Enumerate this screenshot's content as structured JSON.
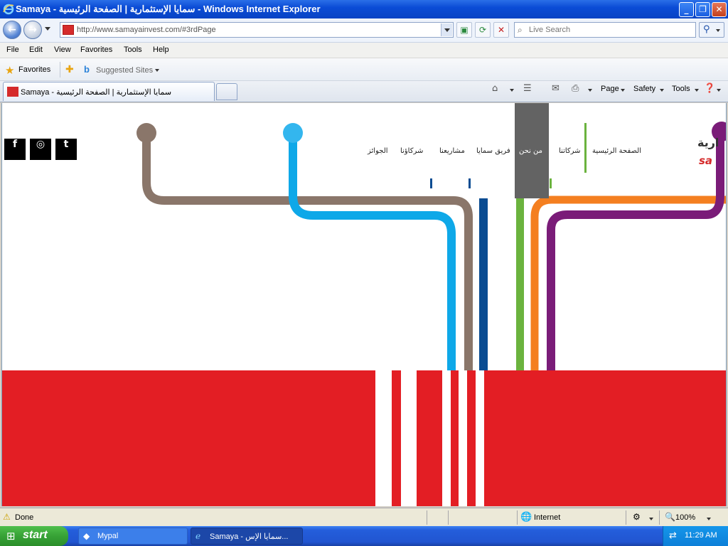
{
  "window": {
    "title": "Samaya - سمايا الإستثمارية | الصفحة الرئيسية - Windows Internet Explorer",
    "minimize": "_",
    "restore": "❐",
    "close": "✕"
  },
  "address_bar": {
    "url": "http://www.samayainvest.com/#3rdPage",
    "search_placeholder": "Live Search"
  },
  "menu": [
    "File",
    "Edit",
    "View",
    "Favorites",
    "Tools",
    "Help"
  ],
  "favorites_bar": {
    "favorites_label": "Favorites",
    "suggested_label": "Suggested Sites"
  },
  "tab": {
    "label": "Samaya - سمايا الإستثمارية | الصفحة الرئيسية"
  },
  "command_bar": {
    "page": "Page",
    "safety": "Safety",
    "tools": "Tools"
  },
  "site": {
    "nav": [
      "الصفحة الرئيسية",
      "شركاتنا",
      "من نحن",
      "فريق سمايا",
      "مشاريعنا",
      "شركاؤنا",
      "الجوائز"
    ],
    "logo_ar": "ارية",
    "logo_en": "sa",
    "social": [
      "f",
      "◎",
      "t"
    ],
    "colors": {
      "brown": "#8a766a",
      "light_blue": "#0ea8e8",
      "dark_blue": "#0a4c92",
      "green": "#6bb33e",
      "orange": "#f47f20",
      "purple": "#7a1c78",
      "red": "#e31e24",
      "nav_active": "#636363"
    }
  },
  "status_bar": {
    "status": "Done",
    "zone": "Internet",
    "zoom": "100%"
  },
  "taskbar": {
    "start": "start",
    "tasks": [
      "Mypal",
      "Samaya - سمايا الإس..."
    ],
    "clock": "11:29 AM"
  }
}
